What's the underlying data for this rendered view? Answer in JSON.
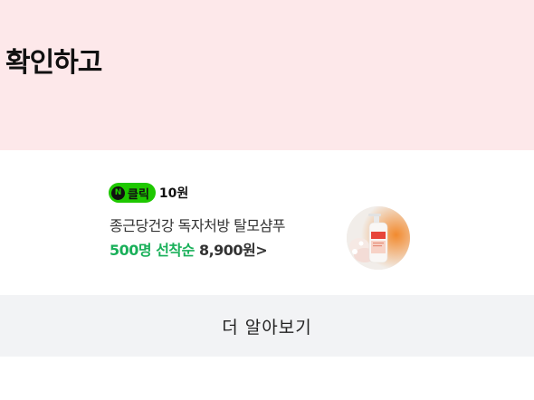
{
  "banner": {
    "headline": "확인하고",
    "background_color": "#fde8ea"
  },
  "ad": {
    "badge_icon": "naver-n-icon",
    "badge_label": "클릭",
    "reward": "10원",
    "product_name": "종근당건강 독자처방 탈모샴푸",
    "promo": "500명 선착순",
    "price": "8,900원>",
    "accent_color": "#1ab05a",
    "thumbnail_icon": "shampoo-bottle-icon"
  },
  "more_button": {
    "label": "더 알아보기"
  }
}
